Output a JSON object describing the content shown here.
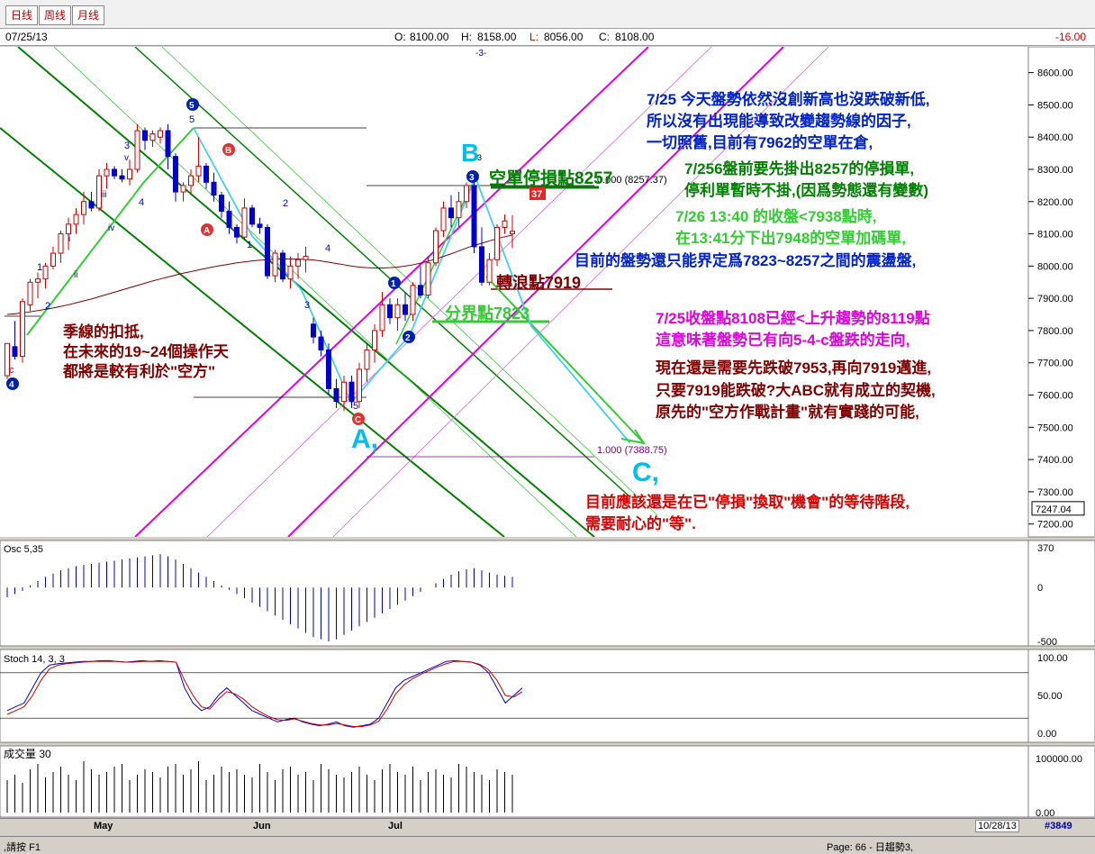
{
  "tabs": [
    {
      "label": "日线"
    },
    {
      "label": "周线"
    },
    {
      "label": "月线"
    }
  ],
  "info": {
    "date": "07/25/13",
    "o_label": "O:",
    "o": "8100.00",
    "h_label": "H:",
    "h": "8158.00",
    "l_label": "L:",
    "l": "8056.00",
    "c_label": "C:",
    "c": "8108.00",
    "change": "-16.00"
  },
  "colors": {
    "up": "#cc0000",
    "down": "#0000cc",
    "green": "#008000",
    "pink": "#e000e0",
    "cyan": "#00c0e8",
    "ma": "#800000"
  },
  "chart_data": [
    {
      "type": "candlestick",
      "title": "",
      "x_labels": [
        "May",
        "Jun",
        "Jul"
      ],
      "y_ticks": [
        8600,
        8500,
        8400,
        8300,
        8200,
        8100,
        8000,
        7900,
        7800,
        7700,
        7600,
        7500,
        7400,
        7300,
        7200
      ],
      "ylim": [
        7160,
        8680
      ],
      "current_value": "7247.04",
      "value_format": "0.00",
      "ohlc": [
        [
          7660,
          7760,
          7650,
          7760
        ],
        [
          7750,
          7830,
          7710,
          7720
        ],
        [
          7720,
          7900,
          7700,
          7890
        ],
        [
          7880,
          7960,
          7860,
          7950
        ],
        [
          7950,
          7980,
          7900,
          7960
        ],
        [
          7960,
          8010,
          7930,
          8000
        ],
        [
          8000,
          8060,
          7990,
          8040
        ],
        [
          8040,
          8110,
          8010,
          8100
        ],
        [
          8100,
          8150,
          8050,
          8130
        ],
        [
          8130,
          8180,
          8100,
          8160
        ],
        [
          8160,
          8230,
          8130,
          8200
        ],
        [
          8200,
          8230,
          8170,
          8180
        ],
        [
          8180,
          8300,
          8170,
          8280
        ],
        [
          8280,
          8320,
          8240,
          8300
        ],
        [
          8300,
          8310,
          8270,
          8280
        ],
        [
          8280,
          8300,
          8260,
          8270
        ],
        [
          8270,
          8330,
          8250,
          8300
        ],
        [
          8300,
          8440,
          8290,
          8420
        ],
        [
          8420,
          8430,
          8360,
          8390
        ],
        [
          8390,
          8420,
          8370,
          8410
        ],
        [
          8400,
          8430,
          8380,
          8420
        ],
        [
          8420,
          8440,
          8300,
          8340
        ],
        [
          8340,
          8350,
          8200,
          8230
        ],
        [
          8230,
          8260,
          8200,
          8250
        ],
        [
          8250,
          8300,
          8220,
          8280
        ],
        [
          8280,
          8400,
          8260,
          8310
        ],
        [
          8310,
          8320,
          8240,
          8260
        ],
        [
          8260,
          8290,
          8200,
          8220
        ],
        [
          8220,
          8230,
          8150,
          8170
        ],
        [
          8170,
          8200,
          8100,
          8120
        ],
        [
          8120,
          8130,
          8070,
          8090
        ],
        [
          8090,
          8210,
          8080,
          8180
        ],
        [
          8180,
          8190,
          8120,
          8130
        ],
        [
          8130,
          8150,
          8100,
          8120
        ],
        [
          8120,
          8130,
          7960,
          7970
        ],
        [
          7970,
          8050,
          7950,
          8040
        ],
        [
          8040,
          8050,
          7950,
          7960
        ],
        [
          7960,
          8030,
          7930,
          8000
        ],
        [
          8000,
          8040,
          7960,
          8020
        ],
        [
          8020,
          8060,
          7980,
          8030
        ],
        [
          7820,
          7840,
          7760,
          7780
        ],
        [
          7780,
          7800,
          7720,
          7740
        ],
        [
          7740,
          7760,
          7600,
          7620
        ],
        [
          7620,
          7650,
          7560,
          7580
        ],
        [
          7580,
          7660,
          7550,
          7640
        ],
        [
          7640,
          7660,
          7560,
          7580
        ],
        [
          7580,
          7700,
          7560,
          7680
        ],
        [
          7680,
          7760,
          7640,
          7740
        ],
        [
          7740,
          7820,
          7700,
          7800
        ],
        [
          7800,
          7920,
          7780,
          7880
        ],
        [
          7880,
          7900,
          7820,
          7840
        ],
        [
          7840,
          7900,
          7800,
          7880
        ],
        [
          7880,
          7920,
          7830,
          7850
        ],
        [
          7850,
          7950,
          7830,
          7940
        ],
        [
          7940,
          8000,
          7900,
          7910
        ],
        [
          7910,
          8030,
          7900,
          8010
        ],
        [
          8010,
          8120,
          8000,
          8110
        ],
        [
          8110,
          8200,
          8090,
          8180
        ],
        [
          8180,
          8220,
          8120,
          8150
        ],
        [
          8150,
          8230,
          8120,
          8200
        ],
        [
          8200,
          8260,
          8180,
          8250
        ],
        [
          8250,
          8260,
          8040,
          8060
        ],
        [
          8060,
          8120,
          7940,
          7950
        ],
        [
          7950,
          8040,
          7940,
          8020
        ],
        [
          8020,
          8130,
          8000,
          8120
        ],
        [
          8120,
          8160,
          8100,
          8140
        ],
        [
          8100,
          8158,
          8056,
          8108
        ]
      ],
      "ma_values": [
        7850,
        7852,
        7855,
        7858,
        7862,
        7866,
        7870,
        7875,
        7880,
        7886,
        7892,
        7898,
        7905,
        7912,
        7919,
        7926,
        7933,
        7940,
        7947,
        7954,
        7960,
        7966,
        7972,
        7978,
        7983,
        7988,
        7993,
        7998,
        8002,
        8006,
        8010,
        8013,
        8016,
        8018,
        8020,
        8021,
        8022,
        8022,
        8022,
        8021,
        8019,
        8016,
        8012,
        8008,
        8004,
        8000,
        7997,
        7995,
        7994,
        7994,
        7995,
        7997,
        8000,
        8004,
        8009,
        8015,
        8022,
        8030,
        8038,
        8047,
        8056,
        8064,
        8071,
        8078,
        8085,
        8091,
        8096
      ]
    },
    {
      "type": "bar",
      "title": "Osc 5,35",
      "y_ticks": [
        370,
        0,
        -500
      ],
      "values": [
        -90,
        -60,
        -30,
        20,
        60,
        100,
        130,
        160,
        180,
        200,
        210,
        220,
        230,
        240,
        250,
        260,
        270,
        280,
        290,
        300,
        310,
        290,
        260,
        220,
        180,
        140,
        100,
        60,
        20,
        -20,
        -60,
        -100,
        -140,
        -180,
        -220,
        -260,
        -300,
        -340,
        -380,
        -420,
        -460,
        -480,
        -500,
        -480,
        -440,
        -400,
        -360,
        -320,
        -280,
        -240,
        -200,
        -160,
        -120,
        -80,
        -40,
        0,
        40,
        80,
        120,
        150,
        170,
        180,
        160,
        140,
        120,
        110,
        100
      ]
    },
    {
      "type": "line",
      "title": "Stoch 14, 3, 3",
      "y_ticks": [
        "100.00",
        "50.00",
        "0.00"
      ],
      "ylim": [
        0,
        100
      ],
      "k": [
        30,
        35,
        40,
        60,
        80,
        90,
        92,
        93,
        94,
        95,
        95,
        96,
        96,
        95,
        94,
        95,
        96,
        95,
        96,
        95,
        94,
        60,
        40,
        30,
        35,
        50,
        60,
        50,
        40,
        30,
        25,
        20,
        15,
        18,
        20,
        15,
        12,
        10,
        12,
        15,
        10,
        8,
        10,
        12,
        20,
        40,
        60,
        70,
        75,
        80,
        85,
        90,
        95,
        96,
        95,
        94,
        90,
        80,
        60,
        40,
        50,
        60
      ],
      "d": [
        25,
        30,
        35,
        50,
        70,
        85,
        90,
        92,
        93,
        94,
        95,
        95,
        95,
        95,
        94,
        94,
        95,
        95,
        95,
        95,
        94,
        70,
        50,
        35,
        32,
        45,
        55,
        52,
        45,
        35,
        28,
        22,
        18,
        17,
        19,
        16,
        13,
        11,
        11,
        13,
        11,
        9,
        9,
        11,
        16,
        32,
        52,
        64,
        72,
        78,
        83,
        88,
        92,
        95,
        95,
        94,
        91,
        84,
        70,
        50,
        48,
        55
      ]
    },
    {
      "type": "bar",
      "title": "成交量 30",
      "y_ticks": [
        "100000.00",
        "0.00"
      ],
      "values": [
        60,
        70,
        55,
        80,
        90,
        65,
        75,
        85,
        70,
        60,
        95,
        80,
        70,
        75,
        85,
        90,
        60,
        70,
        80,
        75,
        65,
        85,
        90,
        70,
        80,
        95,
        60,
        70,
        85,
        75,
        80,
        70,
        65,
        90,
        75,
        60,
        80,
        85,
        70,
        75,
        60,
        90,
        80,
        70,
        65,
        75,
        85,
        70,
        60,
        80,
        90,
        75,
        70,
        85,
        60,
        75,
        80,
        70,
        65,
        90,
        85,
        75,
        70,
        60,
        80,
        75,
        70
      ]
    }
  ],
  "wave_labels": {
    "top_marker": "-3-",
    "w5": "5",
    "w5b": "5",
    "wB": "B",
    "wA": "A",
    "w3": "3",
    "wv": "v",
    "wiii": "iii",
    "wiv": "iv",
    "wi": "i",
    "wii": "ii",
    "w4": "4",
    "w1": "1",
    "w2": "2",
    "wc": "c",
    "w4b": "4",
    "w1b": "1",
    "w2b": "2",
    "w3b": "3",
    "w4c": "4",
    "w5c": "5",
    "wCr": "C",
    "w3c": "3",
    "w1c": "1",
    "w2c": "2",
    "w37": "37",
    "bigB": "B",
    "bigBsub": "3",
    "bigA": "A,",
    "bigC": "C,",
    "fib0": "0.000 (8257.37)",
    "fib1": "1.000 (7388.75)"
  },
  "annotations": {
    "stop": "空單停損點8257",
    "turn": "轉浪點7919",
    "divide": "分界點7823",
    "season": [
      "季線的扣抵,",
      "在未來的19~24個操作天",
      "都將是較有利於\"空方\""
    ],
    "blue1": [
      "7/25 今天盤勢依然沒創新高也沒跌破新低,",
      "所以沒有出現能導致改變趨勢線的因子,",
      "一切照舊,目前有7962的空單在倉,"
    ],
    "green1": [
      "7/256盤前要先掛出8257的停損單,",
      "停利單暫時不掛,(因爲勢態還有變數)"
    ],
    "lime1": [
      "7/26  13:40 的收盤<7938點時,",
      "在13:41分下出7948的空單加碼單,"
    ],
    "range": "目前的盤勢還只能界定爲7823~8257之間的震盪盤,",
    "pink1": [
      "7/25收盤點8108已經<上升趨勢的8119點",
      "這意味著盤勢已有向5-4-c盤跌的走向,"
    ],
    "red1": [
      "現在還是需要先跌破7953,再向7919邁進,",
      "只要7919能跌破?大ABC就有成立的契機,",
      "原先的\"空方作戰計畫\"就有實踐的可能,"
    ],
    "red2": [
      "目前應該還是在已\"停損\"換取\"機會\"的等待階段,",
      "需要耐心的\"等\"."
    ]
  },
  "bottom": {
    "date": "10/28/13",
    "id": "#3849"
  },
  "status": {
    "left": ",請按 F1",
    "right": "Page: 66 - 日趨勢3,"
  }
}
